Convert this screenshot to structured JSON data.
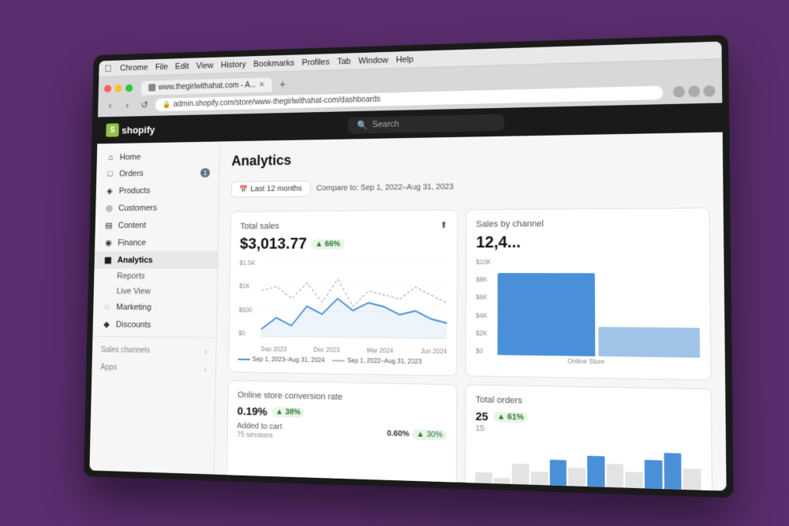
{
  "mac_menu": {
    "app": "Chrome",
    "items": [
      "File",
      "Edit",
      "View",
      "History",
      "Bookmarks",
      "Profiles",
      "Tab",
      "Window",
      "Help"
    ]
  },
  "browser": {
    "tab_title": "www.thegirlwithahat.com - A...",
    "tab_add_label": "+",
    "nav_back": "‹",
    "nav_forward": "›",
    "nav_refresh": "↺",
    "address": "admin.shopify.com/store/www-thegirlwithahat-com/dashboards",
    "lock_icon": "🔒"
  },
  "shopify": {
    "logo_text": "shopify",
    "search_placeholder": "Search"
  },
  "sidebar": {
    "items": [
      {
        "icon": "⌂",
        "label": "Home"
      },
      {
        "icon": "□",
        "label": "Orders",
        "badge": "1"
      },
      {
        "icon": "◈",
        "label": "Products"
      },
      {
        "icon": "◎",
        "label": "Customers"
      },
      {
        "icon": "▤",
        "label": "Content"
      },
      {
        "icon": "◉",
        "label": "Finance"
      },
      {
        "icon": "▦",
        "label": "Analytics",
        "active": true
      },
      {
        "icon": "",
        "label": "Reports",
        "sub": true
      },
      {
        "icon": "",
        "label": "Live View",
        "sub": true
      },
      {
        "icon": "◌",
        "label": "Marketing"
      },
      {
        "icon": "◆",
        "label": "Discounts"
      }
    ],
    "sections": [
      {
        "label": "Sales channels"
      },
      {
        "label": "Apps"
      }
    ]
  },
  "page": {
    "title": "Analytics",
    "filter_period": "Last 12 months",
    "filter_icon": "📅",
    "compare_text": "Compare to: Sep 1, 2022–Aug 31, 2023"
  },
  "total_sales_card": {
    "title": "Total sales",
    "value": "$3,013.77",
    "change": "▲ 66%",
    "change_positive": true,
    "y_labels": [
      "$1.5K",
      "$1K",
      "$500",
      "$0"
    ],
    "x_labels": [
      "Sep 2023",
      "Dec 2023",
      "Mar 2024",
      "Jun 2024"
    ],
    "legend": [
      {
        "label": "Sep 1, 2023–Aug 31, 2024",
        "type": "solid"
      },
      {
        "label": "Sep 1, 2022–Aug 31, 2023",
        "type": "dashed"
      }
    ]
  },
  "sales_by_channel_card": {
    "title": "Sales by channel",
    "y_labels": [
      "$10K",
      "$8K",
      "$6K",
      "$4K",
      "$2K",
      "$0"
    ],
    "bars": [
      {
        "label": "Online Store",
        "value1": 85,
        "value2": 30
      }
    ],
    "side_value": "12,4..."
  },
  "conversion_card": {
    "title": "Online store conversion rate",
    "value": "0.19%",
    "change": "▲ 38%",
    "rows": [
      {
        "label": "Added to cart",
        "sublabel": "75 sessions",
        "value": "0.60%",
        "change": "▲ 30%"
      }
    ]
  },
  "total_orders_card": {
    "title": "Total orders",
    "value": "25",
    "change": "▲ 61%",
    "sub_label": "15",
    "bars": [
      30,
      20,
      50,
      35,
      60,
      45,
      70,
      55,
      40,
      65,
      80,
      50
    ]
  }
}
